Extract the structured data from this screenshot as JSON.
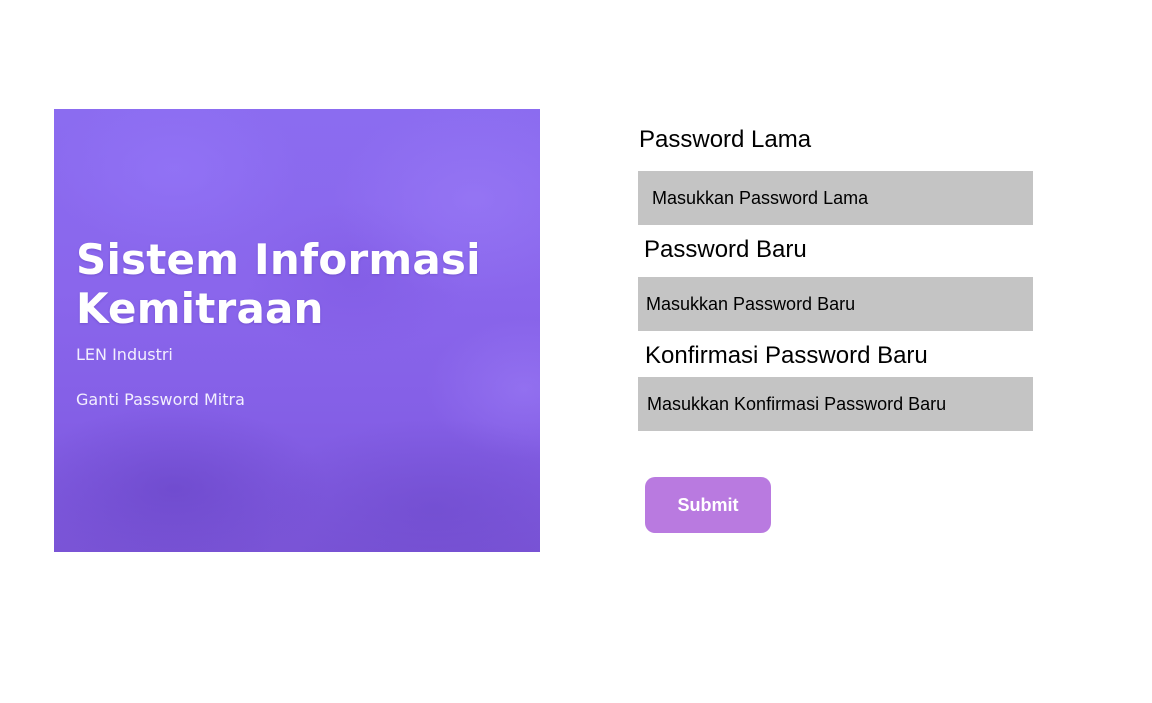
{
  "banner": {
    "title_line1": "Sistem Informasi",
    "title_line2": "Kemitraan",
    "company": "LEN Industri",
    "page_name": "Ganti Password Mitra"
  },
  "form": {
    "old_password": {
      "label": "Password Lama",
      "placeholder": "Masukkan Password Lama",
      "value": ""
    },
    "new_password": {
      "label": "Password Baru",
      "placeholder": "Masukkan Password Baru",
      "value": ""
    },
    "confirm_password": {
      "label": "Konfirmasi Password Baru",
      "placeholder": "Masukkan Konfirmasi Password Baru",
      "value": ""
    },
    "submit_label": "Submit"
  },
  "colors": {
    "banner_purple": "#8a66ec",
    "input_background": "#c4c4c4",
    "submit_button": "#b97ae0",
    "submit_text": "#ffffff"
  }
}
